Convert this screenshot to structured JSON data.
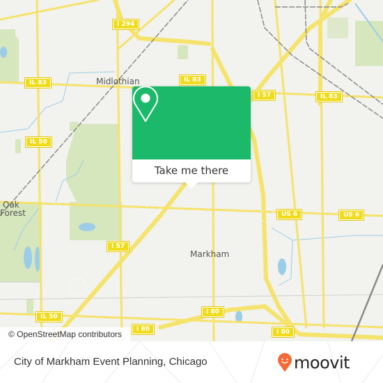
{
  "map": {
    "place_labels": [
      {
        "id": "midlothian",
        "text": "Midlothian"
      },
      {
        "id": "oak",
        "text": "Oak"
      },
      {
        "id": "forest",
        "text": "Forest"
      },
      {
        "id": "markham",
        "text": "Markham"
      }
    ],
    "road_shields": [
      {
        "id": "i294",
        "text": "I 294"
      },
      {
        "id": "il83-left",
        "text": "IL 83"
      },
      {
        "id": "il83-mid",
        "text": "IL 83"
      },
      {
        "id": "i57-top",
        "text": "I 57"
      },
      {
        "id": "il83-right",
        "text": "IL 83"
      },
      {
        "id": "il50-top",
        "text": "IL 50"
      },
      {
        "id": "us6-left",
        "text": "US 6"
      },
      {
        "id": "us6-right",
        "text": "US 6"
      },
      {
        "id": "i57-mid",
        "text": "I 57"
      },
      {
        "id": "il50-bottom",
        "text": "IL 50"
      },
      {
        "id": "i80-left",
        "text": "I 80"
      },
      {
        "id": "i80-mid",
        "text": "I 80"
      },
      {
        "id": "i80-right",
        "text": "I 80"
      }
    ],
    "attribution": "© OpenStreetMap contributors"
  },
  "popup": {
    "icon": "map-pin-icon",
    "button_label": "Take me there",
    "color": "#1db96a"
  },
  "footer": {
    "title": "City of Markham Event Planning, Chicago",
    "brand": "moovit",
    "brand_color": "#f26a35"
  }
}
